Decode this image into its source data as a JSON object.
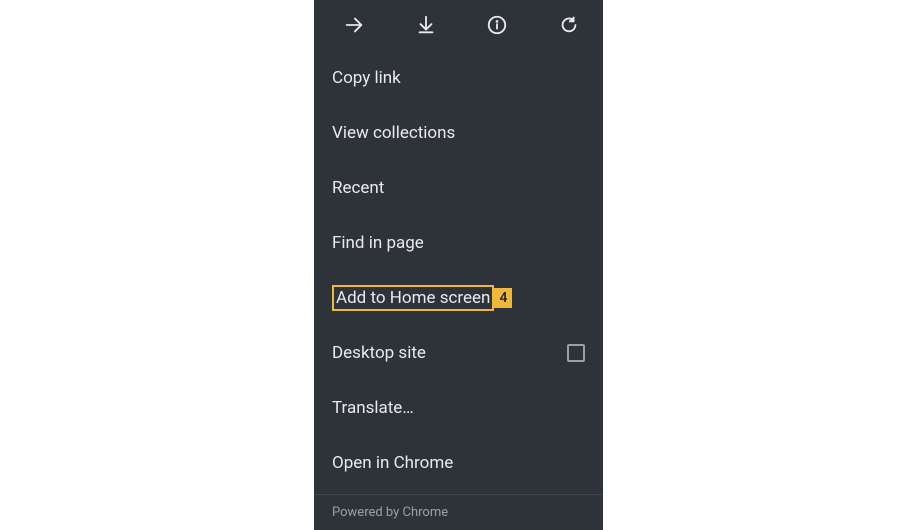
{
  "toolbar": {
    "forward": "forward",
    "download": "download",
    "info": "info",
    "refresh": "refresh"
  },
  "menu": {
    "copy_link": "Copy link",
    "view_collections": "View collections",
    "recent": "Recent",
    "find_in_page": "Find in page",
    "add_to_home": "Add to Home screen",
    "add_to_home_badge": "4",
    "desktop_site": "Desktop site",
    "desktop_site_checked": false,
    "translate": "Translate…",
    "open_in_chrome": "Open in Chrome"
  },
  "footer": {
    "powered_by": "Powered by Chrome"
  }
}
